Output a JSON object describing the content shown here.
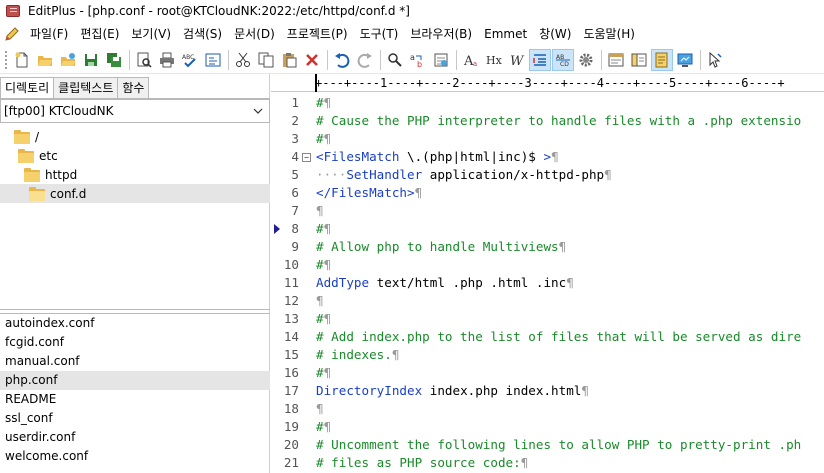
{
  "window": {
    "title": "EditPlus - [php.conf - root@KTCloudNK:2022:/etc/httpd/conf.d *]"
  },
  "menu": [
    "파일(F)",
    "편집(E)",
    "보기(V)",
    "검색(S)",
    "문서(D)",
    "프로젝트(P)",
    "도구(T)",
    "브라우저(B)",
    "Emmet",
    "창(W)",
    "도움말(H)"
  ],
  "toolbar": {
    "icons": [
      "new-file-icon",
      "open-file-icon",
      "open-remote-icon",
      "save-icon",
      "save-all-icon",
      "print-preview-icon",
      "print-icon",
      "spell-check-icon",
      "compare-icon",
      "cut-icon",
      "copy-icon",
      "paste-icon",
      "delete-icon",
      "undo-icon",
      "redo-icon",
      "find-icon",
      "replace-icon",
      "go-to-icon",
      "font-icon",
      "heading-icon",
      "word-wrap-icon",
      "line-number-icon",
      "ruler-icon",
      "settings-icon",
      "document-icon",
      "browser-icon",
      "clipboard-icon",
      "screen-icon",
      "pointer-icon"
    ]
  },
  "left_panel": {
    "tabs": [
      "디렉토리",
      "클립텍스트",
      "함수"
    ],
    "active_tab": 0,
    "drive": "[ftp00] KTCloudNK",
    "tree": [
      {
        "label": "/",
        "depth": 0
      },
      {
        "label": "etc",
        "depth": 1
      },
      {
        "label": "httpd",
        "depth": 2
      },
      {
        "label": "conf.d",
        "depth": 3,
        "selected": true
      }
    ],
    "files": [
      "autoindex.conf",
      "fcgid.conf",
      "manual.conf",
      "php.conf",
      "README",
      "ssl_conf",
      "userdir.conf",
      "welcome.conf"
    ],
    "selected_file": "php.conf"
  },
  "editor": {
    "ruler": "+---+----1----+----2----+----3----+----4----+----5----+----6----+",
    "lines": [
      {
        "n": "1",
        "parts": [
          {
            "t": "#",
            "c": "com"
          },
          {
            "t": "¶",
            "c": "mk"
          }
        ]
      },
      {
        "n": "2",
        "parts": [
          {
            "t": "# Cause the PHP interpreter to handle files with a .php extensio",
            "c": "com"
          }
        ]
      },
      {
        "n": "3",
        "parts": [
          {
            "t": "#",
            "c": "com"
          },
          {
            "t": "¶",
            "c": "mk"
          }
        ]
      },
      {
        "n": "4",
        "fold": "−",
        "parts": [
          {
            "t": "<FilesMatch",
            "c": "kw"
          },
          {
            "t": " \\.(php|html|inc)$ ",
            "c": "txt"
          },
          {
            "t": ">",
            "c": "kw"
          },
          {
            "t": "¶",
            "c": "mk"
          }
        ]
      },
      {
        "n": "5",
        "parts": [
          {
            "t": "····",
            "c": "mk"
          },
          {
            "t": "SetHandler",
            "c": "kw"
          },
          {
            "t": " application/x-httpd-php",
            "c": "txt"
          },
          {
            "t": "¶",
            "c": "mk"
          }
        ]
      },
      {
        "n": "6",
        "parts": [
          {
            "t": "</FilesMatch>",
            "c": "kw"
          },
          {
            "t": "¶",
            "c": "mk"
          }
        ]
      },
      {
        "n": "7",
        "parts": [
          {
            "t": "¶",
            "c": "mk"
          }
        ]
      },
      {
        "n": "8",
        "marker": true,
        "parts": [
          {
            "t": "#",
            "c": "com"
          },
          {
            "t": "¶",
            "c": "mk"
          }
        ]
      },
      {
        "n": "9",
        "parts": [
          {
            "t": "# Allow php to handle Multiviews",
            "c": "com"
          },
          {
            "t": "¶",
            "c": "mk"
          }
        ]
      },
      {
        "n": "10",
        "parts": [
          {
            "t": "#",
            "c": "com"
          },
          {
            "t": "¶",
            "c": "mk"
          }
        ]
      },
      {
        "n": "11",
        "parts": [
          {
            "t": "AddType",
            "c": "kw"
          },
          {
            "t": " text/html .php .html .inc",
            "c": "txt"
          },
          {
            "t": "¶",
            "c": "mk"
          }
        ]
      },
      {
        "n": "12",
        "parts": [
          {
            "t": "¶",
            "c": "mk"
          }
        ]
      },
      {
        "n": "13",
        "parts": [
          {
            "t": "#",
            "c": "com"
          },
          {
            "t": "¶",
            "c": "mk"
          }
        ]
      },
      {
        "n": "14",
        "parts": [
          {
            "t": "# Add index.php to the list of files that will be served as dire",
            "c": "com"
          }
        ]
      },
      {
        "n": "15",
        "parts": [
          {
            "t": "# indexes.",
            "c": "com"
          },
          {
            "t": "¶",
            "c": "mk"
          }
        ]
      },
      {
        "n": "16",
        "parts": [
          {
            "t": "#",
            "c": "com"
          },
          {
            "t": "¶",
            "c": "mk"
          }
        ]
      },
      {
        "n": "17",
        "parts": [
          {
            "t": "DirectoryIndex",
            "c": "kw"
          },
          {
            "t": " index.php index.html",
            "c": "txt"
          },
          {
            "t": "¶",
            "c": "mk"
          }
        ]
      },
      {
        "n": "18",
        "parts": [
          {
            "t": "¶",
            "c": "mk"
          }
        ]
      },
      {
        "n": "19",
        "parts": [
          {
            "t": "#",
            "c": "com"
          },
          {
            "t": "¶",
            "c": "mk"
          }
        ]
      },
      {
        "n": "20",
        "parts": [
          {
            "t": "# Uncomment the following lines to allow PHP to pretty-print .ph",
            "c": "com"
          }
        ]
      },
      {
        "n": "21",
        "parts": [
          {
            "t": "# files as PHP source code:",
            "c": "com"
          },
          {
            "t": "¶",
            "c": "mk"
          }
        ]
      }
    ]
  },
  "colors": {
    "comment": "#1a8a2a",
    "keyword": "#1a3ec7",
    "selection": "#e5e5e5"
  }
}
